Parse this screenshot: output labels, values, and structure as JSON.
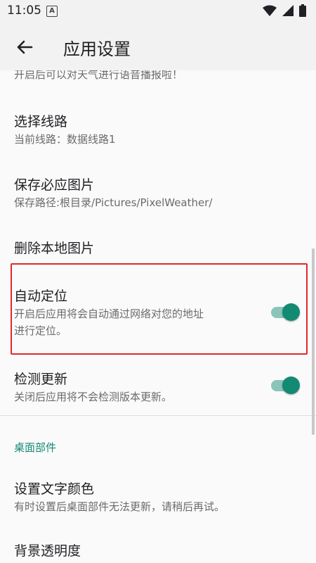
{
  "status_bar": {
    "time": "11:05",
    "notification_letter": "A",
    "icons": [
      "wifi-icon",
      "signal-icon",
      "battery-icon"
    ]
  },
  "app_bar": {
    "back_icon": "arrow-back-icon",
    "title": "应用设置"
  },
  "settings": {
    "top_partial_subtitle": "开启后可以对天气进行语音播报啦！",
    "route": {
      "title": "选择线路",
      "subtitle": "当前线路：数据线路1"
    },
    "save_image": {
      "title": "保存必应图片",
      "subtitle": "保存路径:根目录/Pictures/PixelWeather/"
    },
    "delete_images": {
      "title": "删除本地图片"
    },
    "auto_location": {
      "title": "自动定位",
      "subtitle_line1": "开启后应用将会自动通过网络对您的地址",
      "subtitle_line2": "进行定位。",
      "enabled": true
    },
    "check_update": {
      "title": "检测更新",
      "subtitle": "关闭后应用将不会检测版本更新。",
      "enabled": true
    },
    "widget_category": "桌面部件",
    "text_color": {
      "title": "设置文字颜色",
      "subtitle": "有时设置后桌面部件无法更新，请稍后再试。"
    },
    "background_opacity": {
      "title": "背景透明度"
    }
  },
  "colors": {
    "accent": "#138a72",
    "highlight_border": "#e0292d"
  }
}
